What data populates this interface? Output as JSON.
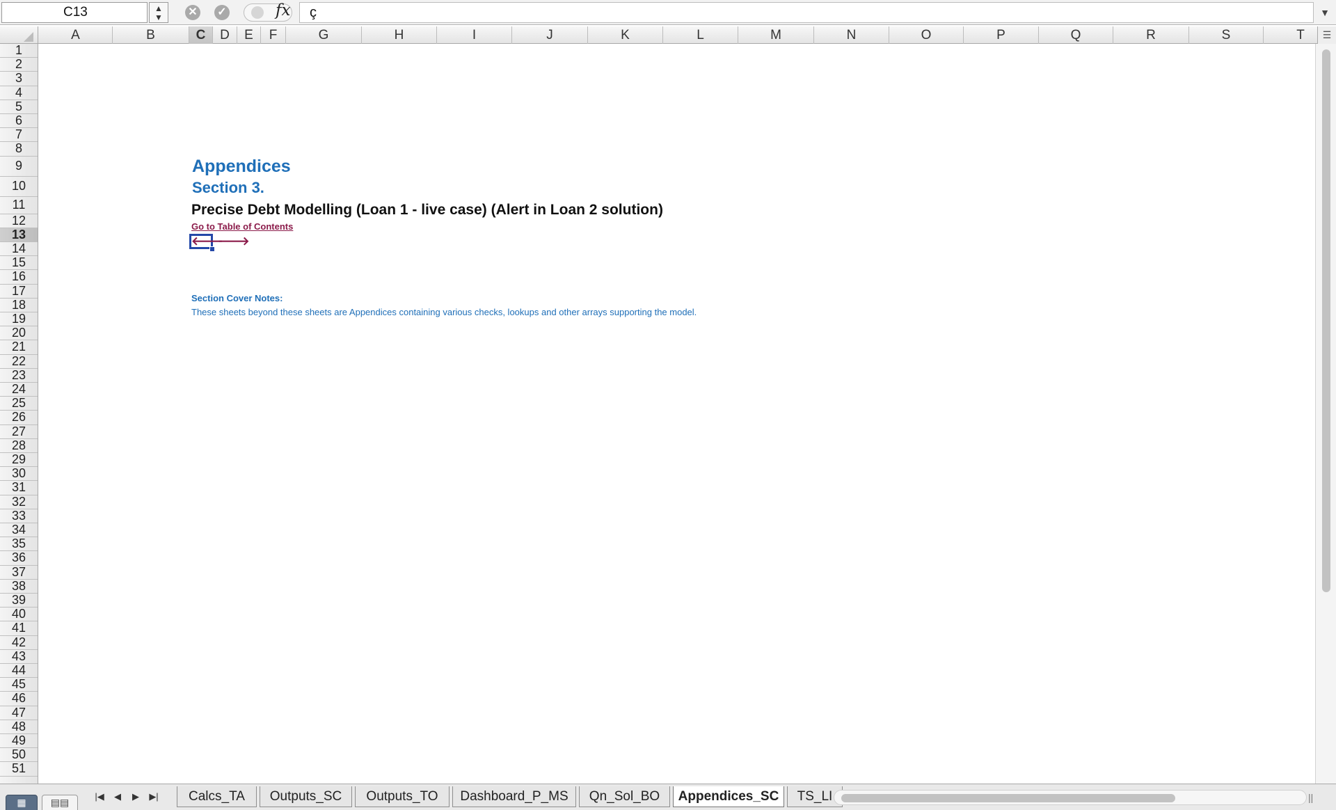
{
  "formula_bar": {
    "name_box": "C13",
    "spinner": "▲\n▼",
    "cancel_icon": "✕",
    "confirm_icon": "✓",
    "fx": "fx",
    "formula": "ç",
    "expand_icon": "▼"
  },
  "columns": [
    {
      "label": "A",
      "w": 106
    },
    {
      "label": "B",
      "w": 110
    },
    {
      "label": "C",
      "w": 34,
      "active": true
    },
    {
      "label": "D",
      "w": 35
    },
    {
      "label": "E",
      "w": 34
    },
    {
      "label": "F",
      "w": 36
    },
    {
      "label": "G",
      "w": 109
    },
    {
      "label": "H",
      "w": 108
    },
    {
      "label": "I",
      "w": 108
    },
    {
      "label": "J",
      "w": 109
    },
    {
      "label": "K",
      "w": 108
    },
    {
      "label": "L",
      "w": 108
    },
    {
      "label": "M",
      "w": 109
    },
    {
      "label": "N",
      "w": 108
    },
    {
      "label": "O",
      "w": 107
    },
    {
      "label": "P",
      "w": 108
    },
    {
      "label": "Q",
      "w": 107
    },
    {
      "label": "R",
      "w": 109
    },
    {
      "label": "S",
      "w": 107
    },
    {
      "label": "T",
      "w": 107
    }
  ],
  "column_menu_icon": "☰",
  "active_row": 13,
  "rows": [
    "1",
    "2",
    "3",
    "4",
    "5",
    "6",
    "7",
    "8",
    "9",
    "10",
    "11",
    "12",
    "13",
    "14",
    "15",
    "16",
    "17",
    "18",
    "19",
    "20",
    "21",
    "22",
    "23",
    "24",
    "25",
    "26",
    "27",
    "28",
    "29",
    "30",
    "31",
    "32",
    "33",
    "34",
    "35",
    "36",
    "37",
    "38",
    "39",
    "40",
    "41",
    "42",
    "43",
    "44",
    "45",
    "46",
    "47",
    "48",
    "49",
    "50",
    "51"
  ],
  "content": {
    "heading": "Appendices",
    "section": "Section 3.",
    "title": "Precise Debt Modelling (Loan 1 - live case) (Alert in Loan 2 solution)",
    "toc_link": "Go to Table of Contents",
    "prev_arrow": "🡐",
    "next_arrow": "🡒",
    "notes_label": "Section Cover Notes:",
    "notes_text": "These sheets beyond these sheets are Appendices containing various checks, lookups and other arrays supporting the model."
  },
  "tab_bar": {
    "view_normal": "▦",
    "view_layout": "▤▤",
    "nav_first": "|◀",
    "nav_prev": "◀",
    "nav_next": "▶",
    "nav_last": "▶|",
    "tabs": [
      {
        "label": "Calcs_TA",
        "w": 115
      },
      {
        "label": "Outputs_SC",
        "w": 133
      },
      {
        "label": "Outputs_TO",
        "w": 136
      },
      {
        "label": "Dashboard_P_MS",
        "w": 178
      },
      {
        "label": "Qn_Sol_BO",
        "w": 131
      },
      {
        "label": "Appendices_SC",
        "w": 160,
        "active": true
      },
      {
        "label": "TS_LI",
        "w": 80
      }
    ],
    "scroll_split": "||"
  }
}
